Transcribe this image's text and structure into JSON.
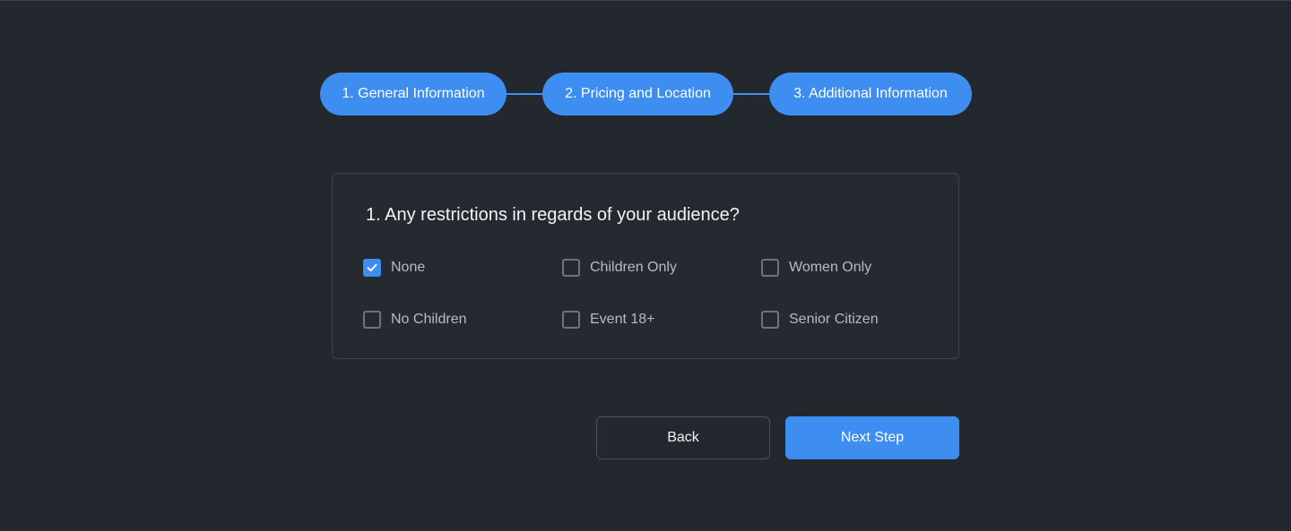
{
  "stepper": {
    "steps": [
      {
        "label": "1. General Information"
      },
      {
        "label": "2. Pricing and Location"
      },
      {
        "label": "3. Additional Information"
      }
    ]
  },
  "question": {
    "title": "1. Any restrictions in regards of your audience?",
    "options": [
      {
        "label": "None",
        "checked": true
      },
      {
        "label": "Children Only",
        "checked": false
      },
      {
        "label": "Women Only",
        "checked": false
      },
      {
        "label": "No Children",
        "checked": false
      },
      {
        "label": "Event 18+",
        "checked": false
      },
      {
        "label": "Senior Citizen",
        "checked": false
      }
    ]
  },
  "actions": {
    "back_label": "Back",
    "next_label": "Next Step"
  },
  "colors": {
    "background": "#23282e",
    "accent": "#3d8ef0",
    "card_border": "#3f454c"
  },
  "icons": {
    "checked": "checkmark-icon"
  }
}
